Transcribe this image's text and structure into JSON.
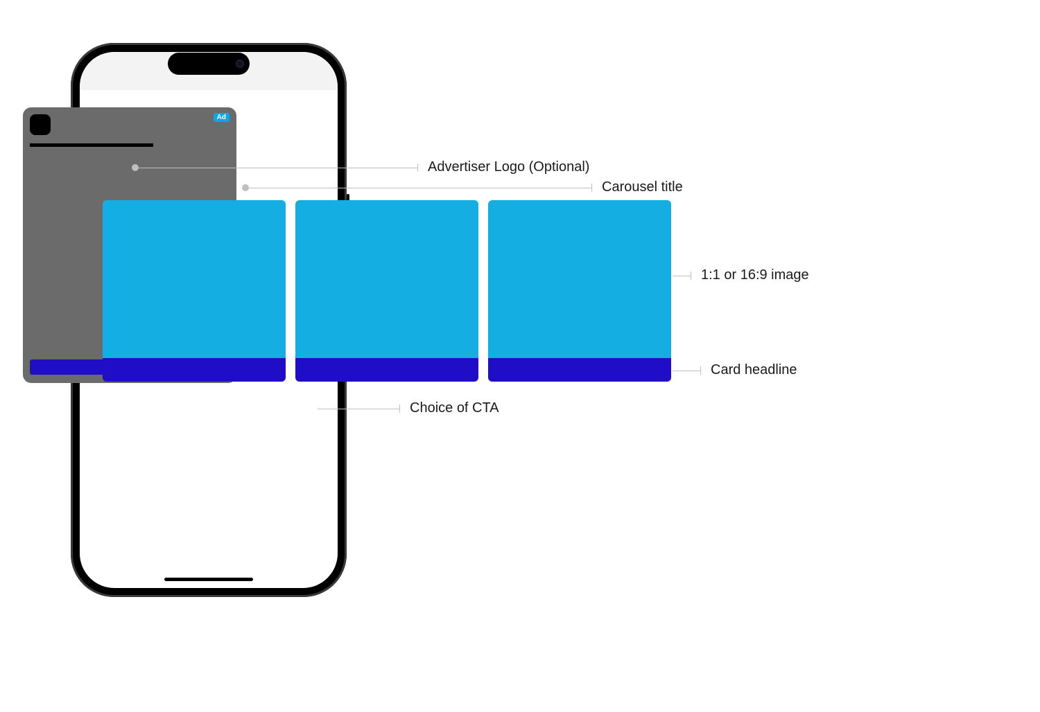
{
  "ad": {
    "badge": "Ad"
  },
  "annotations": {
    "advertiser_logo": "Advertiser Logo (Optional)",
    "carousel_title": "Carousel title",
    "image_ratio": "1:1 or 16:9 image",
    "card_headline": "Card headline",
    "cta": "Choice of CTA"
  },
  "colors": {
    "card_bg": "#6b6b6b",
    "image_fill": "#14aee3",
    "headline_fill": "#1f0dc8",
    "badge_bg": "#15a4e3"
  }
}
